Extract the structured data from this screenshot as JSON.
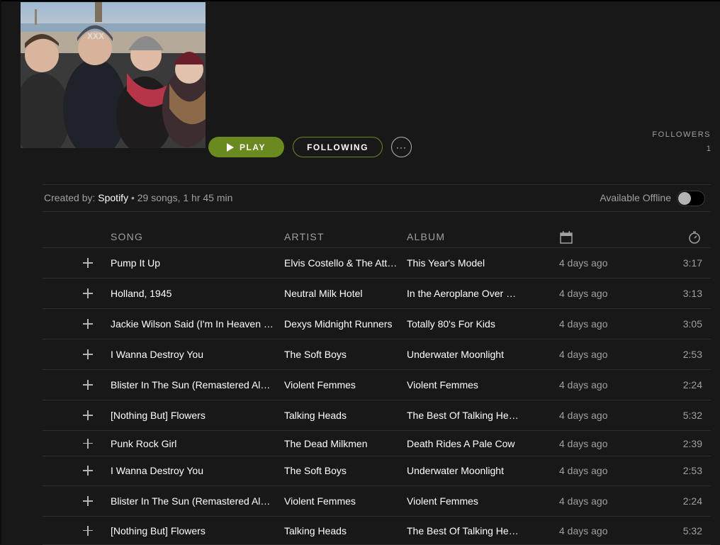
{
  "header": {
    "play_label": "PLAY",
    "following_label": "FOLLOWING",
    "more_label": "···",
    "followers_label": "FOLLOWERS",
    "followers_count": "1"
  },
  "meta": {
    "created_by_label": "Created by:",
    "owner": "Spotify",
    "summary": " • 29 songs, 1 hr 45 min",
    "offline_label": "Available Offline",
    "offline_enabled": false
  },
  "table": {
    "columns": {
      "song": "SONG",
      "artist": "ARTIST",
      "album": "ALBUM",
      "added_icon": "calendar-icon",
      "duration_icon": "stopwatch-icon"
    },
    "rows": [
      {
        "song": "Pump It Up",
        "artist": "Elvis Costello & The Att…",
        "album": "This Year's Model",
        "added": "4 days ago",
        "duration": "3:17"
      },
      {
        "song": "Holland, 1945",
        "artist": "Neutral Milk Hotel",
        "album": "In the Aeroplane Over …",
        "added": "4 days ago",
        "duration": "3:13"
      },
      {
        "song": "Jackie Wilson Said (I'm In Heaven …",
        "artist": "Dexys Midnight Runners",
        "album": "Totally 80's For Kids",
        "added": "4 days ago",
        "duration": "3:05"
      },
      {
        "song": "I Wanna Destroy You",
        "artist": "The Soft Boys",
        "album": "Underwater Moonlight",
        "added": "4 days ago",
        "duration": "2:53"
      },
      {
        "song": "Blister In The Sun (Remastered Al…",
        "artist": "Violent Femmes",
        "album": "Violent Femmes",
        "added": "4 days ago",
        "duration": "2:24"
      },
      {
        "song": "[Nothing But] Flowers",
        "artist": "Talking Heads",
        "album": "The Best Of Talking He…",
        "added": "4 days ago",
        "duration": "5:32"
      },
      {
        "song": "Punk Rock Girl",
        "artist": "The Dead Milkmen",
        "album": "Death Rides A Pale Cow",
        "added": "4 days ago",
        "duration": "2:39"
      },
      {
        "song": "I Wanna Destroy You",
        "artist": "The Soft Boys",
        "album": "Underwater Moonlight",
        "added": "4 days ago",
        "duration": "2:53"
      },
      {
        "song": "Blister In The Sun (Remastered Al…",
        "artist": "Violent Femmes",
        "album": "Violent Femmes",
        "added": "4 days ago",
        "duration": "2:24"
      },
      {
        "song": "[Nothing But] Flowers",
        "artist": "Talking Heads",
        "album": "The Best Of Talking He…",
        "added": "4 days ago",
        "duration": "5:32"
      }
    ]
  },
  "colors": {
    "background": "#181818",
    "accent": "#6a8a1f",
    "muted_text": "#a0a0a0",
    "divider": "#2c2c2c"
  }
}
